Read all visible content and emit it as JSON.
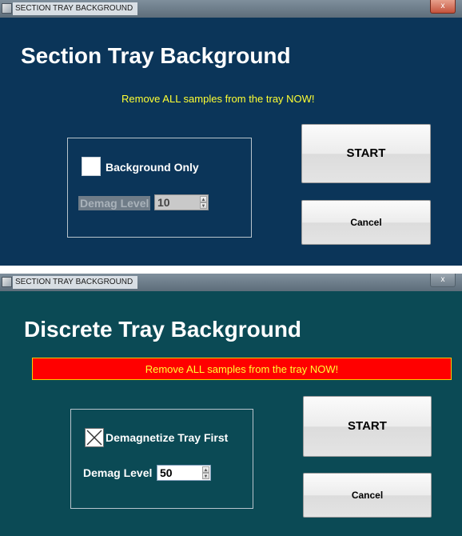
{
  "section_window": {
    "title_bar": "SECTION TRAY BACKGROUND",
    "close_glyph": "x",
    "heading": "Section Tray Background",
    "warning": "Remove ALL samples from the tray NOW!",
    "checkbox_label": "Background Only",
    "checkbox_checked": false,
    "demag_label": "Demag Level",
    "demag_value": "10",
    "start_label": "START",
    "cancel_label": "Cancel",
    "bg_color": "#0b3559",
    "warning_color": "#ffff33"
  },
  "discrete_window": {
    "title_bar": "SECTION TRAY BACKGROUND",
    "close_glyph": "x",
    "heading": "Discrete Tray Background",
    "warning": "Remove ALL samples from the tray NOW!",
    "checkbox_label": "Demagnetize Tray First",
    "checkbox_checked": true,
    "demag_label": "Demag Level",
    "demag_value": "50",
    "start_label": "START",
    "cancel_label": "Cancel",
    "bg_color": "#0b4a55",
    "warning_color": "#ffff33",
    "warning_bg": "#ff0000"
  },
  "icons": [
    "app-icon",
    "close-icon",
    "spinner-up-icon",
    "spinner-down-icon",
    "checkbox-check-icon"
  ]
}
